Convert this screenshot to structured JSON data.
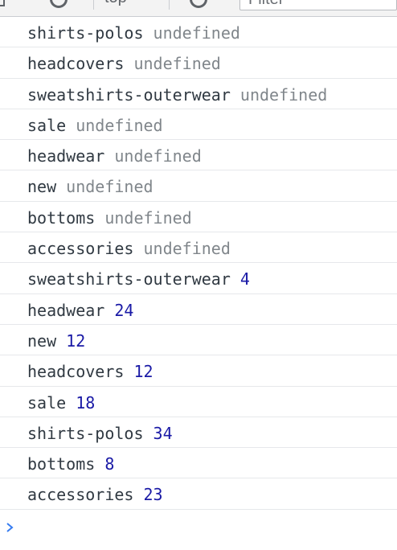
{
  "toolbar": {
    "context_label": "top",
    "filter_placeholder": "Filter"
  },
  "colors": {
    "label": "#303942",
    "undefined_value": "#80868b",
    "number_value": "#1a1aa6",
    "prompt": "#367cf1",
    "row_divider": "#e6e8eb"
  },
  "console": {
    "rows": [
      {
        "label": "shirts-polos",
        "value": "undefined"
      },
      {
        "label": "headcovers",
        "value": "undefined"
      },
      {
        "label": "sweatshirts-outerwear",
        "value": "undefined"
      },
      {
        "label": "sale",
        "value": "undefined"
      },
      {
        "label": "headwear",
        "value": "undefined"
      },
      {
        "label": "new",
        "value": "undefined"
      },
      {
        "label": "bottoms",
        "value": "undefined"
      },
      {
        "label": "accessories",
        "value": "undefined"
      },
      {
        "label": "sweatshirts-outerwear",
        "value": "4"
      },
      {
        "label": "headwear",
        "value": "24"
      },
      {
        "label": "new",
        "value": "12"
      },
      {
        "label": "headcovers",
        "value": "12"
      },
      {
        "label": "sale",
        "value": "18"
      },
      {
        "label": "shirts-polos",
        "value": "34"
      },
      {
        "label": "bottoms",
        "value": "8"
      },
      {
        "label": "accessories",
        "value": "23"
      }
    ],
    "prompt_icon": "chevron-right-icon"
  }
}
